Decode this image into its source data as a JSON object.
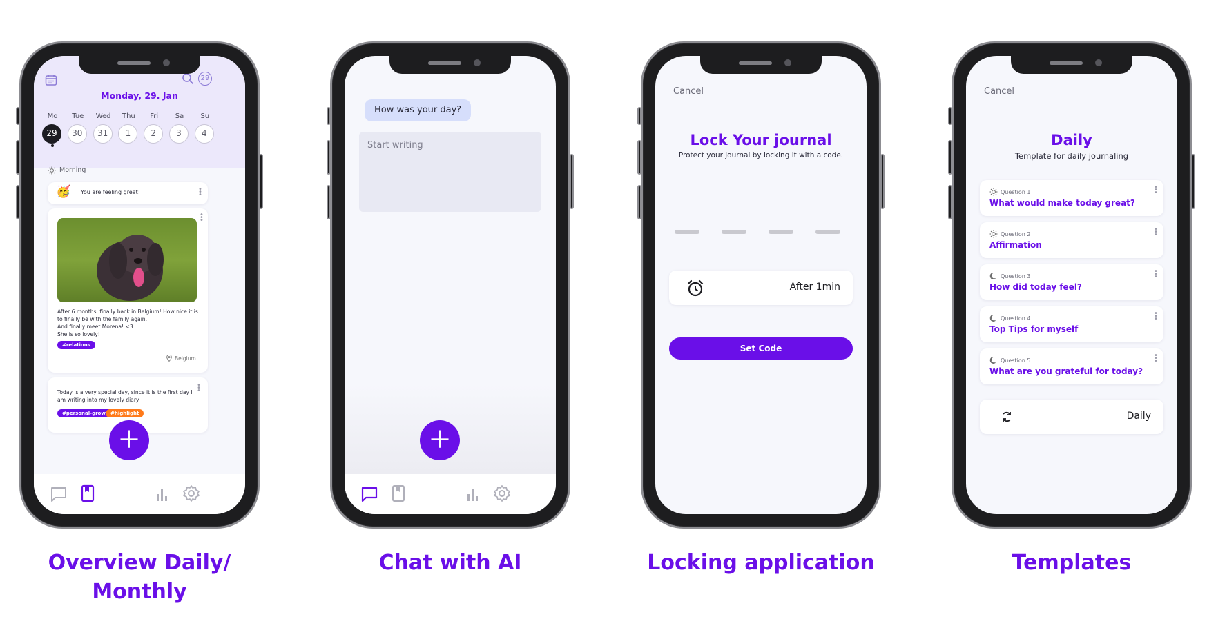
{
  "captions": [
    "Overview Daily/\nMonthly",
    "Chat with AI",
    "Locking application",
    "Templates"
  ],
  "overview": {
    "date_title": "Monday, 29. Jan",
    "calendar_badge": "29",
    "days": [
      {
        "name": "Mo",
        "num": "29",
        "active": true
      },
      {
        "name": "Tue",
        "num": "30"
      },
      {
        "name": "Wed",
        "num": "31"
      },
      {
        "name": "Thu",
        "num": "1"
      },
      {
        "name": "Fri",
        "num": "2"
      },
      {
        "name": "Sa",
        "num": "3"
      },
      {
        "name": "Su",
        "num": "4"
      }
    ],
    "section_label": "Morning",
    "mood_text": "You are feeling great!",
    "mood_emoji": "🥳",
    "entry_text": "After 6 months, finally back in Belgium! How nice it is to finally be with the family again.\nAnd finally meet Morena! <3\nShe is so lovely!",
    "entry_tag": "#relations",
    "entry_location": "Belgium",
    "entry2_text": "Today is a very special day, since it is the first day I am writing into my lovely diary",
    "entry2_tags": [
      "#personal-growth",
      "#highlight"
    ],
    "fab_label": "+"
  },
  "chat": {
    "bubble": "How was your day?",
    "placeholder": "Start writing",
    "fab_label": "+"
  },
  "lock": {
    "cancel": "Cancel",
    "title": "Lock Your journal",
    "subtitle": "Protect your journal by locking it with a code.",
    "timer_value": "After 1min",
    "set_code": "Set Code"
  },
  "templates": {
    "cancel": "Cancel",
    "title": "Daily",
    "subtitle": "Template for daily journaling",
    "questions": [
      {
        "label": "Question 1",
        "title": "What would make today great?",
        "icon": "sun-icon"
      },
      {
        "label": "Question 2",
        "title": "Affirmation",
        "icon": "sun-icon"
      },
      {
        "label": "Question 3",
        "title": "How did today feel?",
        "icon": "moon-icon"
      },
      {
        "label": "Question 4",
        "title": "Top Tips for myself",
        "icon": "moon-icon"
      },
      {
        "label": "Question 5",
        "title": "What are you grateful for today?",
        "icon": "moon-icon"
      }
    ],
    "selector_value": "Daily"
  },
  "colors": {
    "accent": "#6a0fe8",
    "orange": "#ff7a1a",
    "header_bg": "#ece8fb",
    "screen_bg": "#f6f7fc"
  }
}
